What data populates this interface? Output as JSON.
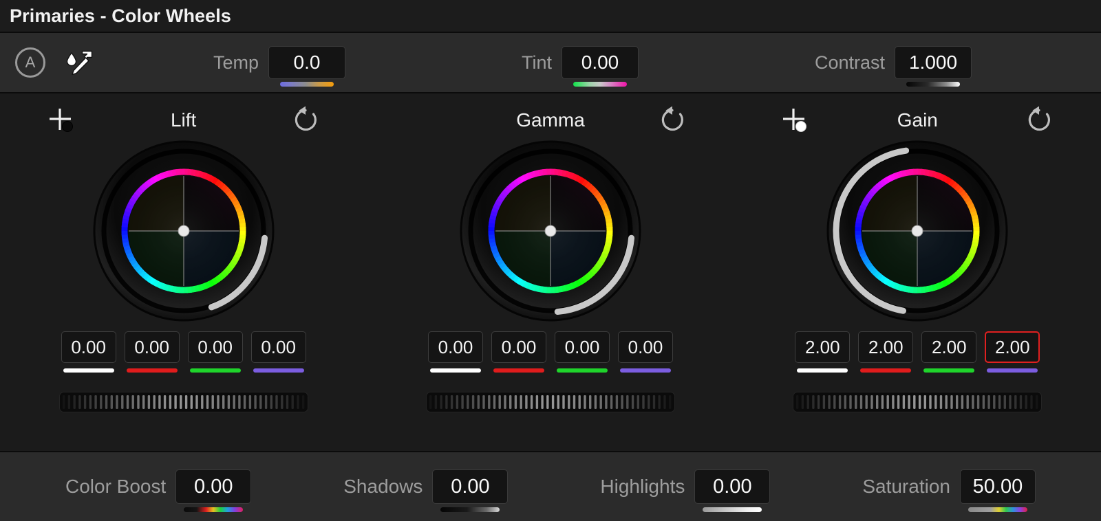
{
  "titlebar": {
    "title": "Primaries - Color Wheels"
  },
  "toolbar": {
    "auto_balance_label": "A",
    "auto_balance_icon": "circle-a-icon",
    "picker_icon": "eyedropper-icon",
    "fields": [
      {
        "label": "Temp",
        "value": "0.0",
        "bar": "grad-temp",
        "name": "temp"
      },
      {
        "label": "Tint",
        "value": "0.00",
        "bar": "grad-tint",
        "name": "tint"
      },
      {
        "label": "Contrast",
        "value": "1.000",
        "bar": "grad-contrast",
        "name": "contrast"
      }
    ]
  },
  "wheels": [
    {
      "name": "lift",
      "title": "Lift",
      "picker_icon": "crosshair-black-dot-icon",
      "has_picker": true,
      "reset_icon": "reset-icon",
      "arc": {
        "start_deg": 95,
        "end_deg": 160
      },
      "values": [
        {
          "value": "0.00",
          "color": "#ffffff",
          "channel": "master",
          "selected": false
        },
        {
          "value": "0.00",
          "color": "#e01c1c",
          "channel": "red",
          "selected": false
        },
        {
          "value": "0.00",
          "color": "#1fd42b",
          "channel": "green",
          "selected": false
        },
        {
          "value": "0.00",
          "color": "#7b5de0",
          "channel": "blue",
          "selected": false
        }
      ]
    },
    {
      "name": "gamma",
      "title": "Gamma",
      "picker_icon": null,
      "has_picker": false,
      "reset_icon": "reset-icon",
      "arc": {
        "start_deg": 95,
        "end_deg": 175
      },
      "values": [
        {
          "value": "0.00",
          "color": "#ffffff",
          "channel": "master",
          "selected": false
        },
        {
          "value": "0.00",
          "color": "#e01c1c",
          "channel": "red",
          "selected": false
        },
        {
          "value": "0.00",
          "color": "#1fd42b",
          "channel": "green",
          "selected": false
        },
        {
          "value": "0.00",
          "color": "#7b5de0",
          "channel": "blue",
          "selected": false
        }
      ]
    },
    {
      "name": "gain",
      "title": "Gain",
      "picker_icon": "crosshair-white-dot-icon",
      "has_picker": true,
      "reset_icon": "reset-icon",
      "arc": {
        "start_deg": 190,
        "end_deg": 352
      },
      "values": [
        {
          "value": "2.00",
          "color": "#ffffff",
          "channel": "master",
          "selected": false
        },
        {
          "value": "2.00",
          "color": "#e01c1c",
          "channel": "red",
          "selected": false
        },
        {
          "value": "2.00",
          "color": "#1fd42b",
          "channel": "green",
          "selected": false
        },
        {
          "value": "2.00",
          "color": "#7b5de0",
          "channel": "blue",
          "selected": true
        }
      ]
    }
  ],
  "bottombar": {
    "fields": [
      {
        "label": "Color Boost",
        "value": "0.00",
        "bar": "grad-colorboost",
        "name": "color-boost"
      },
      {
        "label": "Shadows",
        "value": "0.00",
        "bar": "grad-shadows",
        "name": "shadows"
      },
      {
        "label": "Highlights",
        "value": "0.00",
        "bar": "grad-highlights",
        "name": "highlights"
      },
      {
        "label": "Saturation",
        "value": "50.00",
        "bar": "grad-saturation",
        "name": "saturation"
      }
    ]
  },
  "colors": {
    "panel_bg": "#1b1b1b",
    "bar_bg": "#2b2b2b",
    "title_bg": "#1c1c1c",
    "field_bg": "#141414",
    "text": "#f2f2f2",
    "label": "#9d9d9d",
    "selected_border": "#e02020"
  }
}
